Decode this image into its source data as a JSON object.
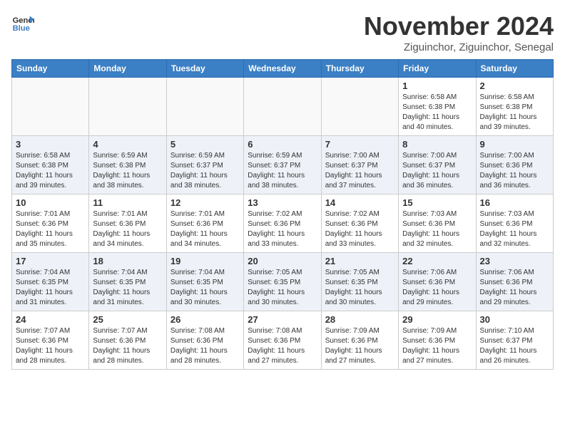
{
  "header": {
    "logo_line1": "General",
    "logo_line2": "Blue",
    "month": "November 2024",
    "location": "Ziguinchor, Ziguinchor, Senegal"
  },
  "days_of_week": [
    "Sunday",
    "Monday",
    "Tuesday",
    "Wednesday",
    "Thursday",
    "Friday",
    "Saturday"
  ],
  "weeks": [
    [
      {
        "day": "",
        "info": ""
      },
      {
        "day": "",
        "info": ""
      },
      {
        "day": "",
        "info": ""
      },
      {
        "day": "",
        "info": ""
      },
      {
        "day": "",
        "info": ""
      },
      {
        "day": "1",
        "info": "Sunrise: 6:58 AM\nSunset: 6:38 PM\nDaylight: 11 hours\nand 40 minutes."
      },
      {
        "day": "2",
        "info": "Sunrise: 6:58 AM\nSunset: 6:38 PM\nDaylight: 11 hours\nand 39 minutes."
      }
    ],
    [
      {
        "day": "3",
        "info": "Sunrise: 6:58 AM\nSunset: 6:38 PM\nDaylight: 11 hours\nand 39 minutes."
      },
      {
        "day": "4",
        "info": "Sunrise: 6:59 AM\nSunset: 6:38 PM\nDaylight: 11 hours\nand 38 minutes."
      },
      {
        "day": "5",
        "info": "Sunrise: 6:59 AM\nSunset: 6:37 PM\nDaylight: 11 hours\nand 38 minutes."
      },
      {
        "day": "6",
        "info": "Sunrise: 6:59 AM\nSunset: 6:37 PM\nDaylight: 11 hours\nand 38 minutes."
      },
      {
        "day": "7",
        "info": "Sunrise: 7:00 AM\nSunset: 6:37 PM\nDaylight: 11 hours\nand 37 minutes."
      },
      {
        "day": "8",
        "info": "Sunrise: 7:00 AM\nSunset: 6:37 PM\nDaylight: 11 hours\nand 36 minutes."
      },
      {
        "day": "9",
        "info": "Sunrise: 7:00 AM\nSunset: 6:36 PM\nDaylight: 11 hours\nand 36 minutes."
      }
    ],
    [
      {
        "day": "10",
        "info": "Sunrise: 7:01 AM\nSunset: 6:36 PM\nDaylight: 11 hours\nand 35 minutes."
      },
      {
        "day": "11",
        "info": "Sunrise: 7:01 AM\nSunset: 6:36 PM\nDaylight: 11 hours\nand 34 minutes."
      },
      {
        "day": "12",
        "info": "Sunrise: 7:01 AM\nSunset: 6:36 PM\nDaylight: 11 hours\nand 34 minutes."
      },
      {
        "day": "13",
        "info": "Sunrise: 7:02 AM\nSunset: 6:36 PM\nDaylight: 11 hours\nand 33 minutes."
      },
      {
        "day": "14",
        "info": "Sunrise: 7:02 AM\nSunset: 6:36 PM\nDaylight: 11 hours\nand 33 minutes."
      },
      {
        "day": "15",
        "info": "Sunrise: 7:03 AM\nSunset: 6:36 PM\nDaylight: 11 hours\nand 32 minutes."
      },
      {
        "day": "16",
        "info": "Sunrise: 7:03 AM\nSunset: 6:36 PM\nDaylight: 11 hours\nand 32 minutes."
      }
    ],
    [
      {
        "day": "17",
        "info": "Sunrise: 7:04 AM\nSunset: 6:35 PM\nDaylight: 11 hours\nand 31 minutes."
      },
      {
        "day": "18",
        "info": "Sunrise: 7:04 AM\nSunset: 6:35 PM\nDaylight: 11 hours\nand 31 minutes."
      },
      {
        "day": "19",
        "info": "Sunrise: 7:04 AM\nSunset: 6:35 PM\nDaylight: 11 hours\nand 30 minutes."
      },
      {
        "day": "20",
        "info": "Sunrise: 7:05 AM\nSunset: 6:35 PM\nDaylight: 11 hours\nand 30 minutes."
      },
      {
        "day": "21",
        "info": "Sunrise: 7:05 AM\nSunset: 6:35 PM\nDaylight: 11 hours\nand 30 minutes."
      },
      {
        "day": "22",
        "info": "Sunrise: 7:06 AM\nSunset: 6:36 PM\nDaylight: 11 hours\nand 29 minutes."
      },
      {
        "day": "23",
        "info": "Sunrise: 7:06 AM\nSunset: 6:36 PM\nDaylight: 11 hours\nand 29 minutes."
      }
    ],
    [
      {
        "day": "24",
        "info": "Sunrise: 7:07 AM\nSunset: 6:36 PM\nDaylight: 11 hours\nand 28 minutes."
      },
      {
        "day": "25",
        "info": "Sunrise: 7:07 AM\nSunset: 6:36 PM\nDaylight: 11 hours\nand 28 minutes."
      },
      {
        "day": "26",
        "info": "Sunrise: 7:08 AM\nSunset: 6:36 PM\nDaylight: 11 hours\nand 28 minutes."
      },
      {
        "day": "27",
        "info": "Sunrise: 7:08 AM\nSunset: 6:36 PM\nDaylight: 11 hours\nand 27 minutes."
      },
      {
        "day": "28",
        "info": "Sunrise: 7:09 AM\nSunset: 6:36 PM\nDaylight: 11 hours\nand 27 minutes."
      },
      {
        "day": "29",
        "info": "Sunrise: 7:09 AM\nSunset: 6:36 PM\nDaylight: 11 hours\nand 27 minutes."
      },
      {
        "day": "30",
        "info": "Sunrise: 7:10 AM\nSunset: 6:37 PM\nDaylight: 11 hours\nand 26 minutes."
      }
    ]
  ]
}
